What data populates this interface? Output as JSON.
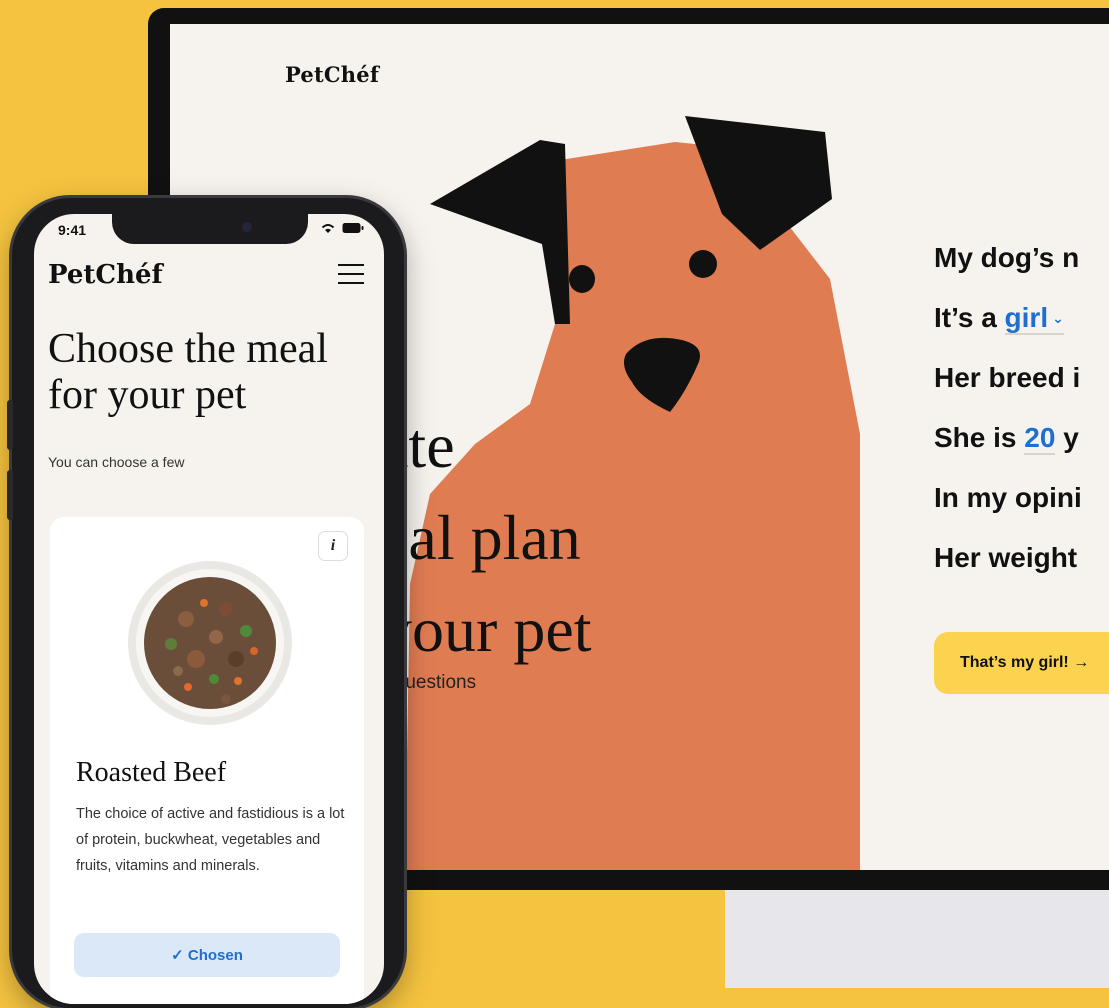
{
  "desktop": {
    "logo": "PetChéf",
    "hero_title_lines": [
      "ate",
      "eal plan",
      "your pet"
    ],
    "hero_subtitle": "v questions",
    "form": {
      "line1": "My dog’s n",
      "line2_prefix": "It’s a ",
      "gender_value": "girl",
      "line3": "Her breed i",
      "line4_prefix": "She is ",
      "age_value": "20",
      "line4_suffix": " y",
      "line5": "In my opini",
      "line6": "Her weight"
    },
    "cta_label": "That’s my girl!  →"
  },
  "phone": {
    "status_time": "9:41",
    "status_icons": "▾ ▬",
    "logo": "PetChéf",
    "title_line1": "Choose the meal",
    "title_line2": "for your pet",
    "subtitle": "You can choose a few",
    "card": {
      "info_label": "i",
      "title": "Roasted Beef",
      "description": "The choice of active and fastidious is a lot of protein, buckwheat, vegetables and fruits, vitamins and minerals.",
      "chosen_label": "✓ Chosen"
    }
  },
  "colors": {
    "background": "#f5c33f",
    "dog": "#e07c52",
    "accent_blue": "#1f6fd0",
    "cta_yellow": "#fcd34f",
    "screen_bg": "#f6f3ee"
  },
  "icons": [
    "hamburger-menu-icon",
    "info-icon",
    "check-icon",
    "arrow-right-icon",
    "wifi-icon",
    "battery-icon"
  ]
}
